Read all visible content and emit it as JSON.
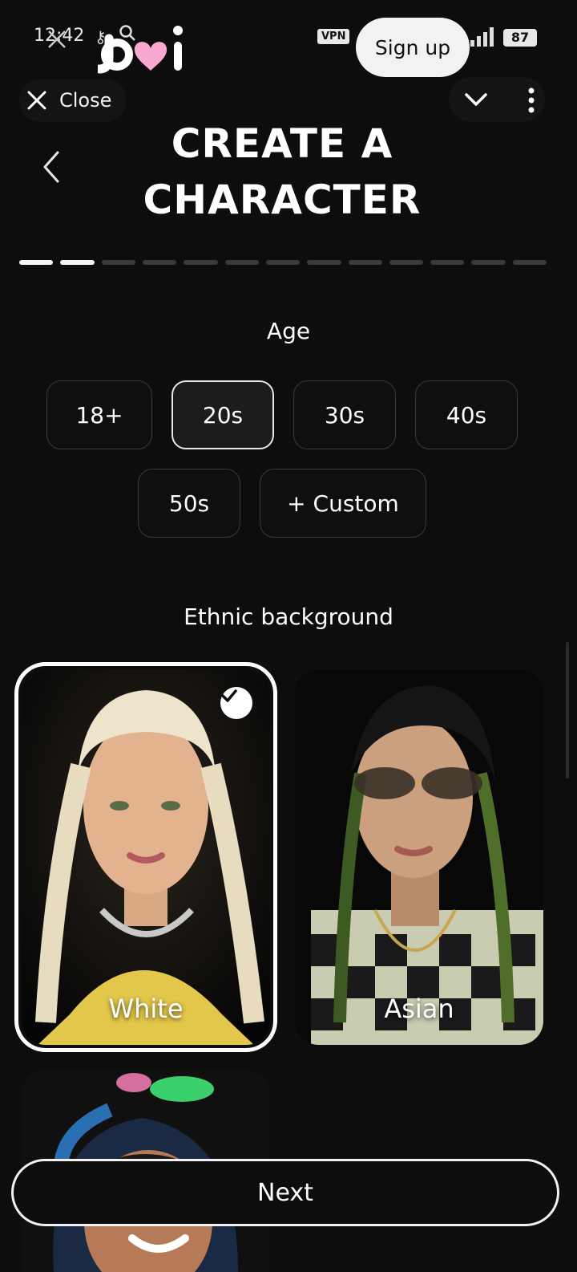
{
  "status_bar": {
    "time": "12:42",
    "vpn": "VPN",
    "battery": "87"
  },
  "header": {
    "close_label": "Close",
    "signup_label": "Sign up",
    "title": "CREATE A CHARACTER"
  },
  "progress": {
    "total_steps": 13,
    "current_step": 2
  },
  "age": {
    "title": "Age",
    "options": [
      "18+",
      "20s",
      "30s",
      "40s",
      "50s",
      "+ Custom"
    ],
    "selected": "20s"
  },
  "ethnicity": {
    "title": "Ethnic background",
    "options": [
      "White",
      "Asian"
    ],
    "selected": "White"
  },
  "footer": {
    "next_label": "Next"
  },
  "colors": {
    "background": "#0d0d0d",
    "accent_pink": "#f9a8cf",
    "text": "#ffffff"
  },
  "icons": [
    "close-icon",
    "chevron-down-icon",
    "more-vert-icon",
    "back-chevron-icon",
    "check-icon",
    "key-icon",
    "search-icon"
  ]
}
